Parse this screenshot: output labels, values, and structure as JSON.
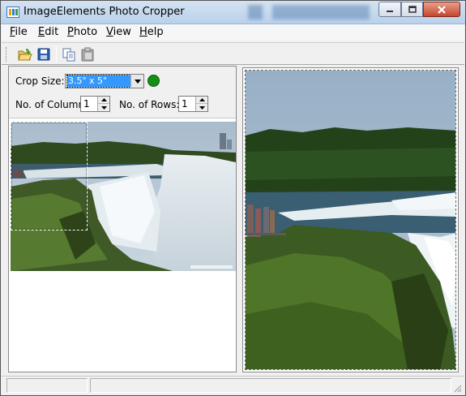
{
  "window": {
    "title": "ImageElements Photo Cropper"
  },
  "menu": [
    {
      "label": "File",
      "accel": "F",
      "rest": "ile"
    },
    {
      "label": "Edit",
      "accel": "E",
      "rest": "dit"
    },
    {
      "label": "Photo",
      "accel": "P",
      "rest": "hoto"
    },
    {
      "label": "View",
      "accel": "V",
      "rest": "iew"
    },
    {
      "label": "Help",
      "accel": "H",
      "rest": "elp"
    }
  ],
  "toolbar": {
    "buttons": [
      {
        "name": "open-icon"
      },
      {
        "name": "save-icon"
      },
      {
        "name": "copy-icon"
      },
      {
        "name": "paste-icon"
      }
    ]
  },
  "crop": {
    "size_label": "Crop Size:",
    "size_value": "3.5\" x 5\"",
    "columns_label": "No. of Columns:",
    "columns_value": "1",
    "rows_label": "No. of Rows:",
    "rows_value": "1",
    "status_color": "#139013"
  }
}
